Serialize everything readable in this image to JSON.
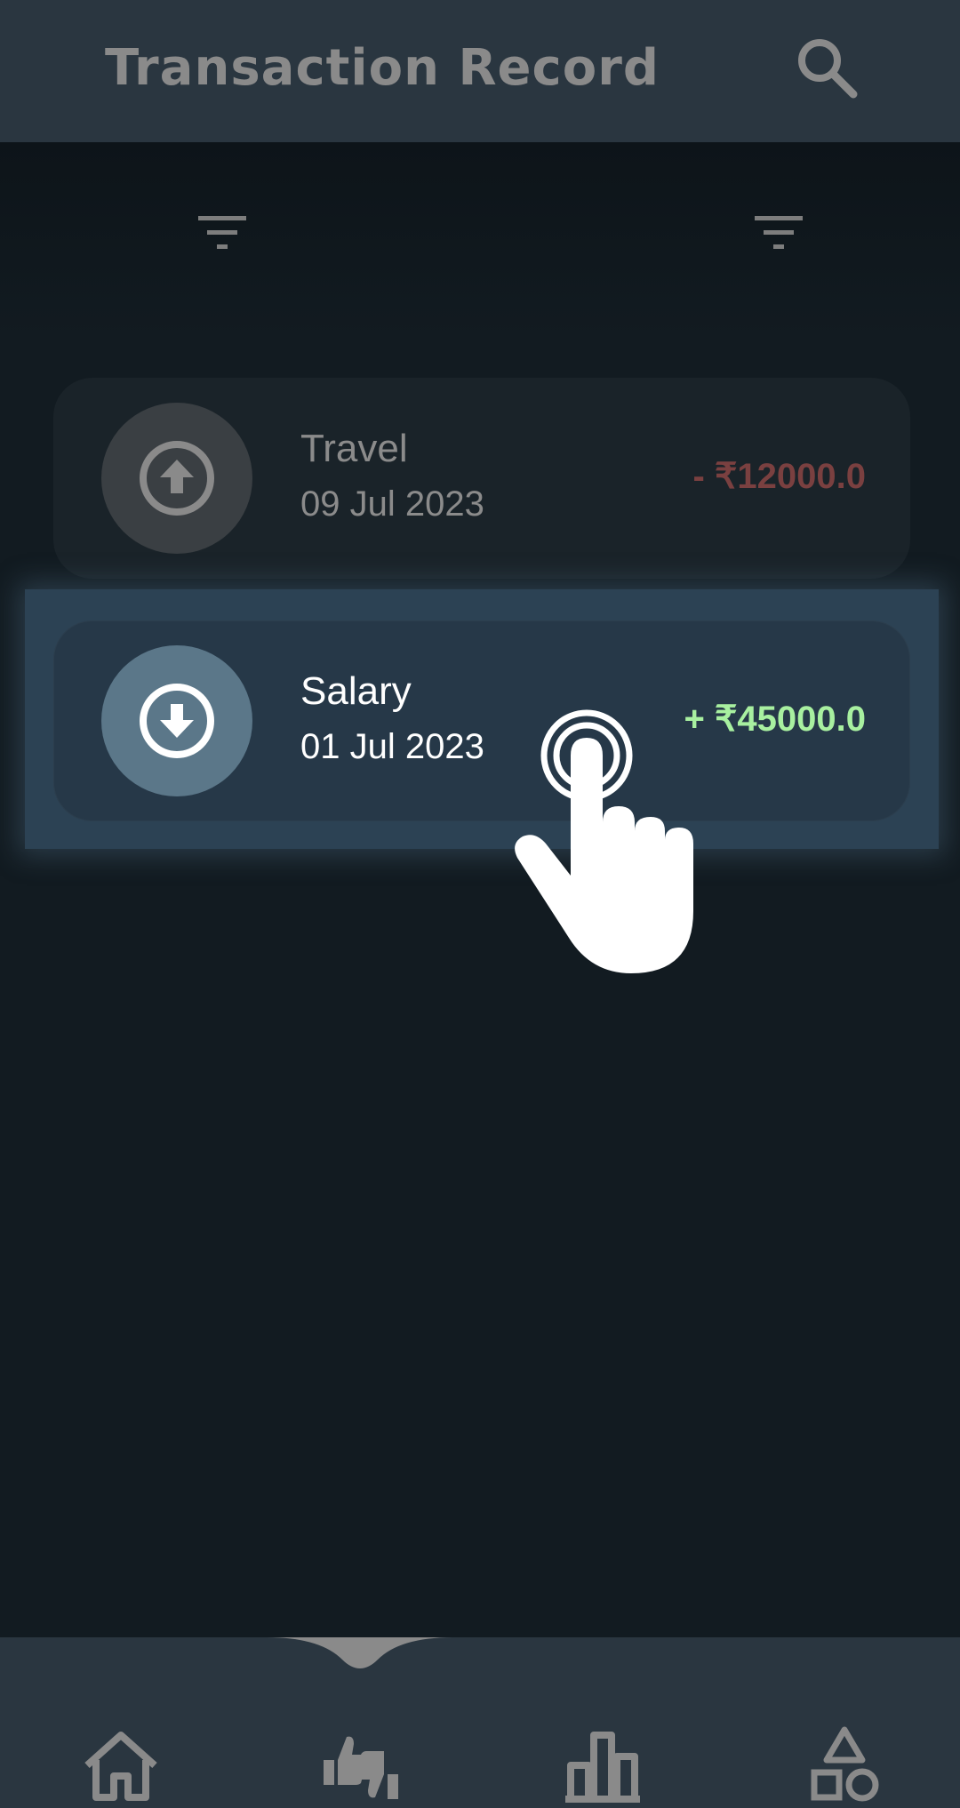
{
  "header": {
    "title": "Transaction Record"
  },
  "transactions": [
    {
      "name": "Travel",
      "date": "09 Jul 2023",
      "amount": "- ₹12000.0",
      "type": "expense"
    },
    {
      "name": "Salary",
      "date": "01 Jul 2023",
      "amount": "+ ₹45000.0",
      "type": "income"
    }
  ],
  "colors": {
    "background": "#121b21",
    "appbar": "#2a3640",
    "income_amount": "#a8f0a0",
    "expense_amount": "#7a4040"
  },
  "icons": [
    "search-icon",
    "filter-icon",
    "arrow-up-circle-icon",
    "arrow-down-circle-icon",
    "tap-hand-icon",
    "home-icon",
    "thumbs-up-down-icon",
    "bar-chart-icon",
    "shapes-icon"
  ]
}
